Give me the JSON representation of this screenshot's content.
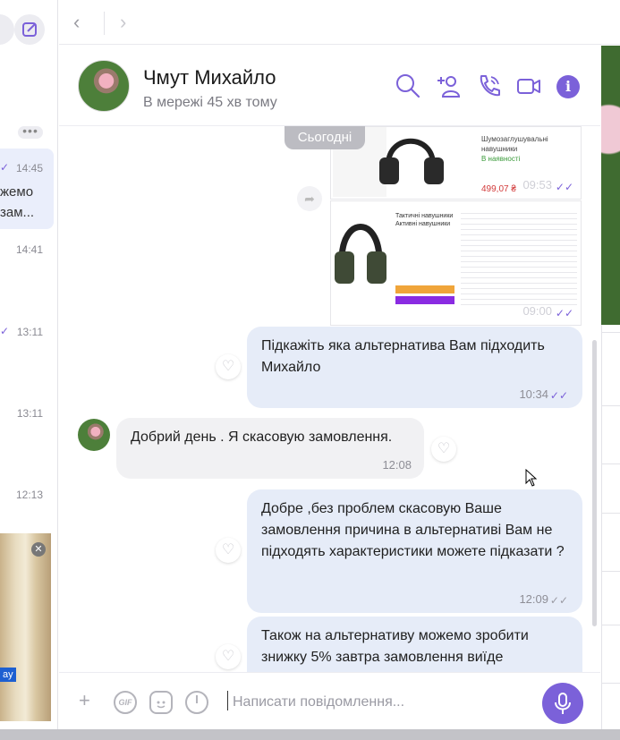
{
  "sidebar": {
    "times": [
      "14:45",
      "14:41",
      "13:11",
      "13:11",
      "12:13"
    ],
    "snippets": [
      "жемо",
      "зам..."
    ],
    "dots": "•••",
    "video_badge": "ay",
    "video_close": "✕"
  },
  "nav": {
    "back": "‹",
    "forward": "›"
  },
  "chat": {
    "name": "Чмут Михайло",
    "status": "В мережі 45 хв тому"
  },
  "header_icons": [
    "search-icon",
    "add-contact-icon",
    "call-icon",
    "video-call-icon",
    "info-icon"
  ],
  "date_divider": "Сьогодні",
  "image_messages": [
    {
      "time": "09:53",
      "tick": "✓✓"
    },
    {
      "time": "09:00",
      "tick": "✓✓"
    }
  ],
  "messages": [
    {
      "direction": "out",
      "text": "Підкажіть яка альтернатива Вам підходить Михайло",
      "time": "10:34",
      "tick": "✓✓"
    },
    {
      "direction": "in",
      "text": "Добрий день . Я скасовую замовлення.",
      "time": "12:08"
    },
    {
      "direction": "out",
      "text": "Добре ,без проблем скасовую Ваше замовлення причина в альтернативі Вам не підходять характеристики можете підказати ?",
      "time": "12:09",
      "tick": "✓✓"
    },
    {
      "direction": "out",
      "text": "Також на альтернативу можемо зробити знижку 5% завтра замовлення виїде",
      "time": "",
      "tick": ""
    }
  ],
  "heart": "♡",
  "composer": {
    "placeholder": "Написати повідомлення...",
    "plus": "+",
    "gif": "GIF"
  },
  "colors": {
    "accent": "#7b61d9",
    "outgoing": "#e6ecf8",
    "incoming": "#f1f1f3"
  }
}
